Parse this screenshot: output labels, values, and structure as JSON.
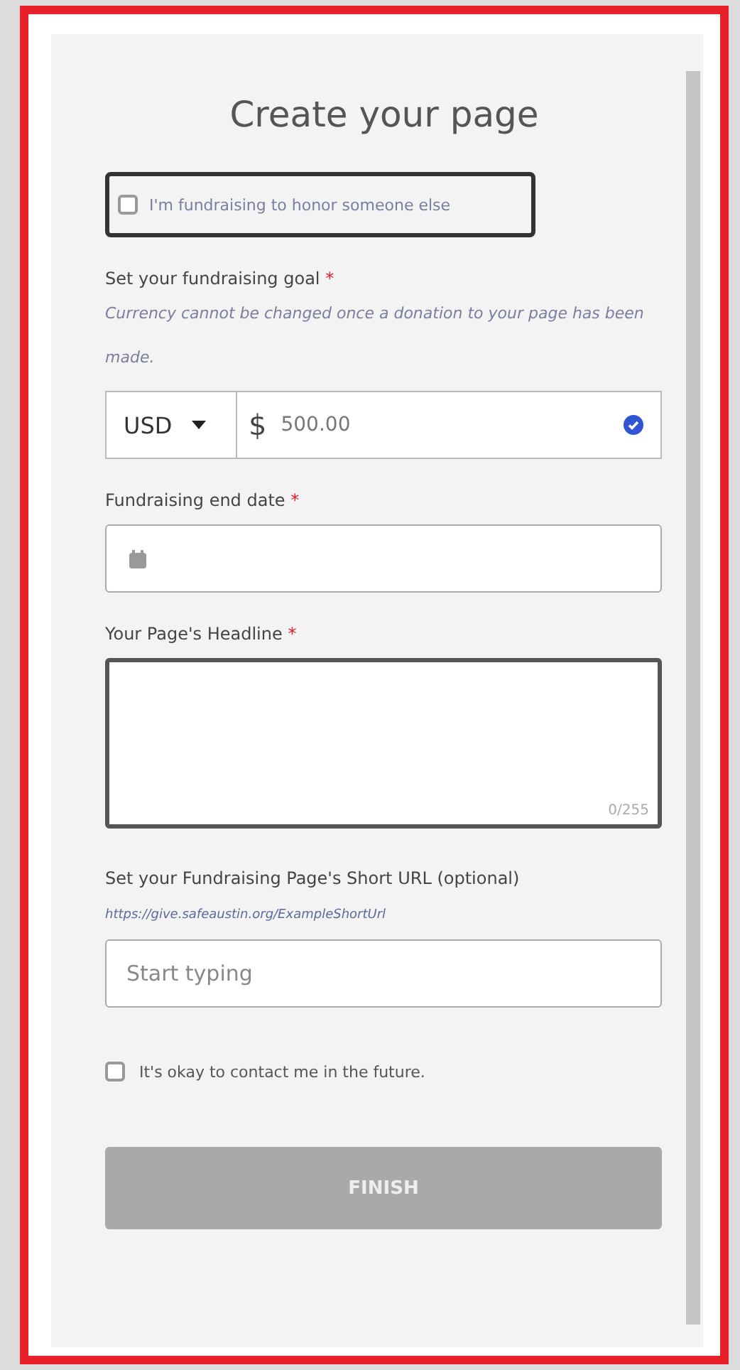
{
  "title": "Create your page",
  "honor": {
    "label": "I'm fundraising to honor someone else",
    "checked": false,
    "focused": true
  },
  "goal": {
    "label": "Set your fundraising goal",
    "required_mark": "*",
    "note": "Currency cannot be changed once a donation to your page has been made.",
    "currency": "USD",
    "symbol": "$",
    "value": "500.00",
    "valid": true
  },
  "end_date": {
    "label": "Fundraising end date",
    "required_mark": "*"
  },
  "headline": {
    "label": "Your Page's Headline",
    "required_mark": "*",
    "counter": "0/255",
    "focused": true
  },
  "short_url": {
    "label": "Set your Fundraising Page's Short URL (optional)",
    "example": "https://give.safeaustin.org/ExampleShortUrl",
    "placeholder": "Start typing"
  },
  "contact": {
    "label": "It's okay to contact me in the future.",
    "checked": false
  },
  "finish": {
    "label": "FINISH",
    "disabled": true
  }
}
